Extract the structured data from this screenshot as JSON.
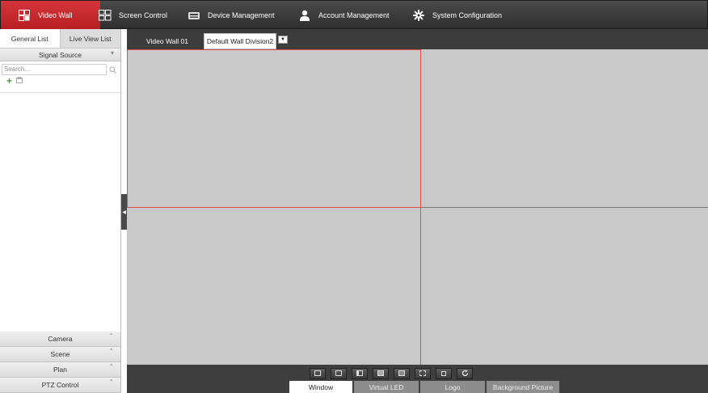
{
  "nav": {
    "items": [
      {
        "label": "Video Wall",
        "icon": "video-wall-icon",
        "active": true
      },
      {
        "label": "Screen Control",
        "icon": "screen-control-icon",
        "active": false
      },
      {
        "label": "Device Management",
        "icon": "device-management-icon",
        "active": false
      },
      {
        "label": "Account Management",
        "icon": "account-management-icon",
        "active": false
      },
      {
        "label": "System Configuration",
        "icon": "system-configuration-icon",
        "active": false
      }
    ]
  },
  "left": {
    "tabs": [
      {
        "label": "General List",
        "active": true
      },
      {
        "label": "Live View List",
        "active": false
      }
    ],
    "signal_source": "Signal Source",
    "search_placeholder": "Search...",
    "sections": [
      "Camera",
      "Scene",
      "Plan",
      "PTZ Control"
    ]
  },
  "wall": {
    "tabs": [
      {
        "label": "Video Wall 01",
        "active": false
      },
      {
        "label": "Default Wall Division2",
        "active": true
      }
    ],
    "layout": {
      "rows": 2,
      "cols": 2,
      "selected_window": 1
    }
  },
  "bottom": {
    "tools": [
      "window-icon",
      "virtual-led-icon",
      "copy-icon",
      "picture-icon",
      "screen-icon",
      "split-icon",
      "fullscreen-icon",
      "refresh-icon"
    ],
    "tabs": [
      {
        "label": "Window",
        "active": true
      },
      {
        "label": "Virtual LED",
        "active": false
      },
      {
        "label": "Logo",
        "active": false
      },
      {
        "label": "Background Picture",
        "active": false
      }
    ]
  },
  "colors": {
    "accent": "#c8282c",
    "selection": "#e04a4a",
    "topbar": "#3a3a3a",
    "wall": "#c9c9c9"
  }
}
